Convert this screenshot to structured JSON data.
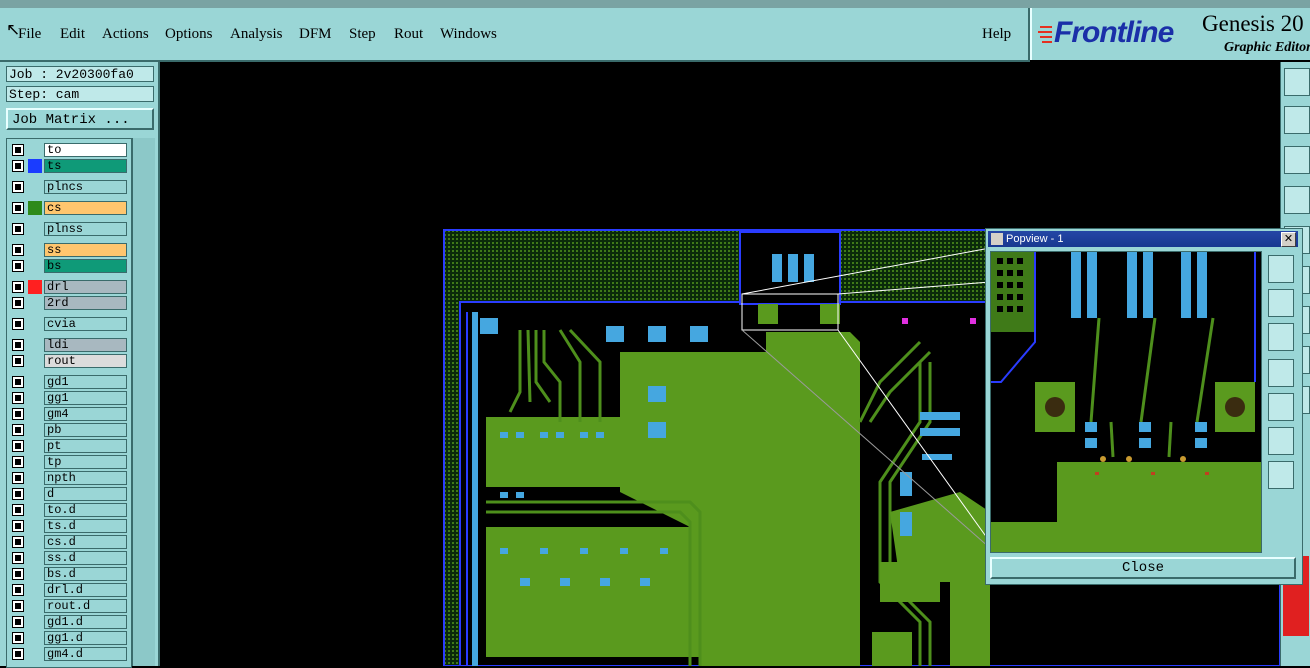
{
  "menu": {
    "items": [
      {
        "label": "File",
        "name": "menu-file"
      },
      {
        "label": "Edit",
        "name": "menu-edit"
      },
      {
        "label": "Actions",
        "name": "menu-actions"
      },
      {
        "label": "Options",
        "name": "menu-options"
      },
      {
        "label": "Analysis",
        "name": "menu-analysis"
      },
      {
        "label": "DFM",
        "name": "menu-dfm"
      },
      {
        "label": "Step",
        "name": "menu-step"
      },
      {
        "label": "Rout",
        "name": "menu-rout"
      },
      {
        "label": "Windows",
        "name": "menu-windows"
      }
    ],
    "help_label": "Help"
  },
  "brand": {
    "logo_text": "Frontline",
    "product": "Genesis 20",
    "subtitle": "Graphic Editor",
    "logo_color": "#1a2fa8"
  },
  "job": {
    "job_label": "Job : 2v20300fa0",
    "step_label": "Step: cam",
    "matrix_button": "Job Matrix ..."
  },
  "layers": [
    {
      "name": "to",
      "color": "",
      "bg": "#ffffff"
    },
    {
      "name": "ts",
      "color": "#1a3cff",
      "bg": "#0f9a78"
    },
    {
      "name": "plncs",
      "color": "",
      "bg": "#9ad6d6"
    },
    {
      "name": "cs",
      "color": "#2e8a1a",
      "bg": "#ffc66e"
    },
    {
      "name": "plnss",
      "color": "",
      "bg": "#9ad6d6"
    },
    {
      "name": "ss",
      "color": "",
      "bg": "#ffc66e"
    },
    {
      "name": "bs",
      "color": "",
      "bg": "#0f9a78"
    },
    {
      "name": "drl",
      "color": "#ff2020",
      "bg": "#a8b8c0"
    },
    {
      "name": "2rd",
      "color": "",
      "bg": "#a8b8c0"
    },
    {
      "name": "cvia",
      "color": "",
      "bg": "#9ad6d6"
    },
    {
      "name": "ldi",
      "color": "",
      "bg": "#a8b8c0"
    },
    {
      "name": "rout",
      "color": "",
      "bg": "#dcdcdc"
    },
    {
      "name": "gd1",
      "color": "",
      "bg": "#9ad6d6"
    },
    {
      "name": "gg1",
      "color": "",
      "bg": "#9ad6d6"
    },
    {
      "name": "gm4",
      "color": "",
      "bg": "#9ad6d6"
    },
    {
      "name": "pb",
      "color": "",
      "bg": "#9ad6d6"
    },
    {
      "name": "pt",
      "color": "",
      "bg": "#9ad6d6"
    },
    {
      "name": "tp",
      "color": "",
      "bg": "#9ad6d6"
    },
    {
      "name": "npth",
      "color": "",
      "bg": "#9ad6d6"
    },
    {
      "name": "d",
      "color": "",
      "bg": "#9ad6d6"
    },
    {
      "name": "to.d",
      "color": "",
      "bg": "#9ad6d6"
    },
    {
      "name": "ts.d",
      "color": "",
      "bg": "#9ad6d6"
    },
    {
      "name": "cs.d",
      "color": "",
      "bg": "#9ad6d6"
    },
    {
      "name": "ss.d",
      "color": "",
      "bg": "#9ad6d6"
    },
    {
      "name": "bs.d",
      "color": "",
      "bg": "#9ad6d6"
    },
    {
      "name": "drl.d",
      "color": "",
      "bg": "#9ad6d6"
    },
    {
      "name": "rout.d",
      "color": "",
      "bg": "#9ad6d6"
    },
    {
      "name": "gd1.d",
      "color": "",
      "bg": "#9ad6d6"
    },
    {
      "name": "gg1.d",
      "color": "",
      "bg": "#9ad6d6"
    },
    {
      "name": "gm4.d",
      "color": "",
      "bg": "#9ad6d6"
    }
  ],
  "popview": {
    "title": "Popview - 1",
    "close_button": "Close"
  },
  "colors": {
    "copper": "#5a9a1e",
    "pad": "#45a7e0",
    "trace": "#4e8f1c",
    "outline": "#2a3cff"
  }
}
